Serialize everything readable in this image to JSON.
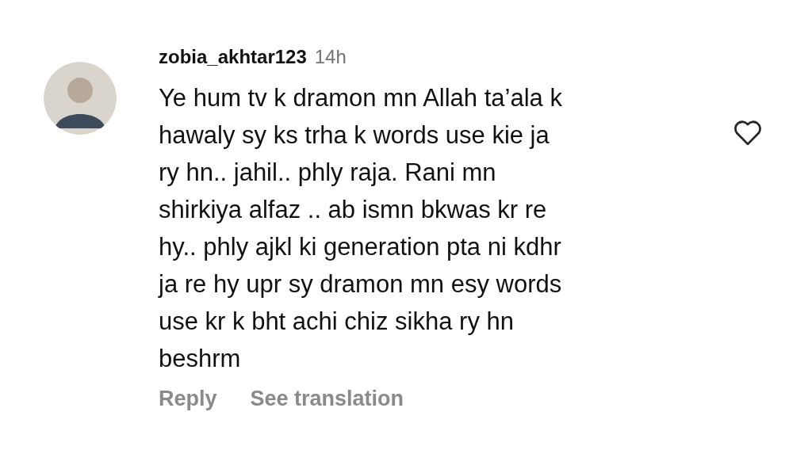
{
  "comment": {
    "username": "zobia_akhtar123",
    "time": "14h",
    "text": "Ye hum tv k dramon mn Allah ta’ala k\nhawaly sy ks trha k words use kie ja\nry hn.. jahil.. phly raja. Rani mn\nshirkiya alfaz .. ab ismn bkwas kr re\nhy.. phly ajkl ki generation pta ni kdhr\nja re hy upr sy dramon mn esy words\nuse kr k bht achi chiz sikha ry hn\nbeshrm",
    "liked": false,
    "actions": [
      "Reply",
      "See translation"
    ]
  }
}
